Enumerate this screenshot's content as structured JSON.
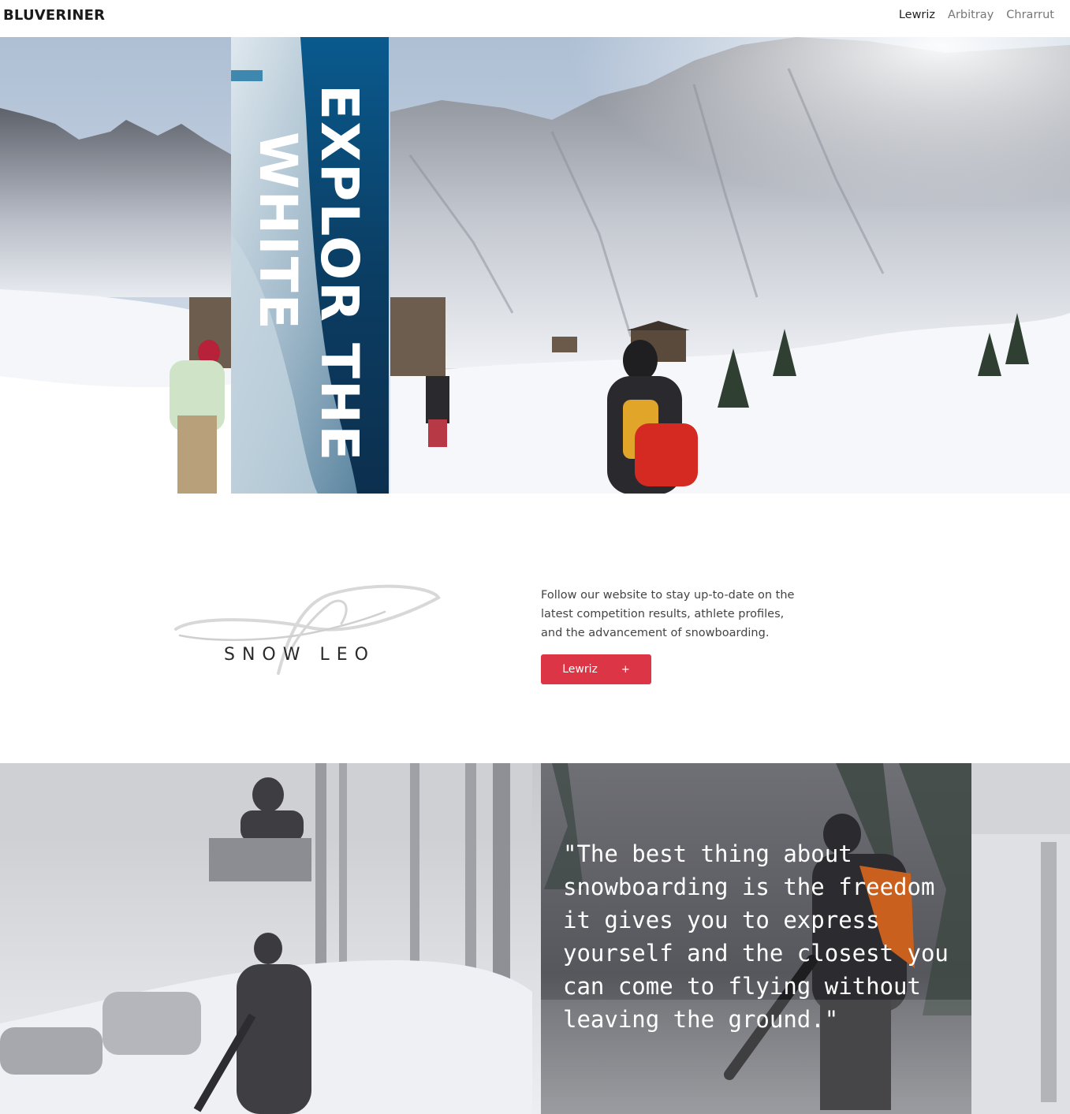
{
  "navbar": {
    "brand": "BLUVERINER",
    "links": [
      {
        "label": "Lewriz",
        "active": true
      },
      {
        "label": "Arbitray",
        "active": false
      },
      {
        "label": "Chrarrut",
        "active": false
      }
    ]
  },
  "hero": {
    "title_line1": "EXPLOR THE",
    "title_line2": "WHITE"
  },
  "intro": {
    "logo_text": "SNOW LEO",
    "description": "Follow our website to stay up-to-date on the latest competition results, athlete profiles, and the advancement of snowboarding.",
    "cta_label": "Lewriz",
    "cta_icon": "+",
    "cta_color": "#dc3545"
  },
  "quote": {
    "text": "\"The best thing about snowboarding is the freedom it gives you to express yourself and the closest you can come to flying without leaving the ground.\""
  }
}
